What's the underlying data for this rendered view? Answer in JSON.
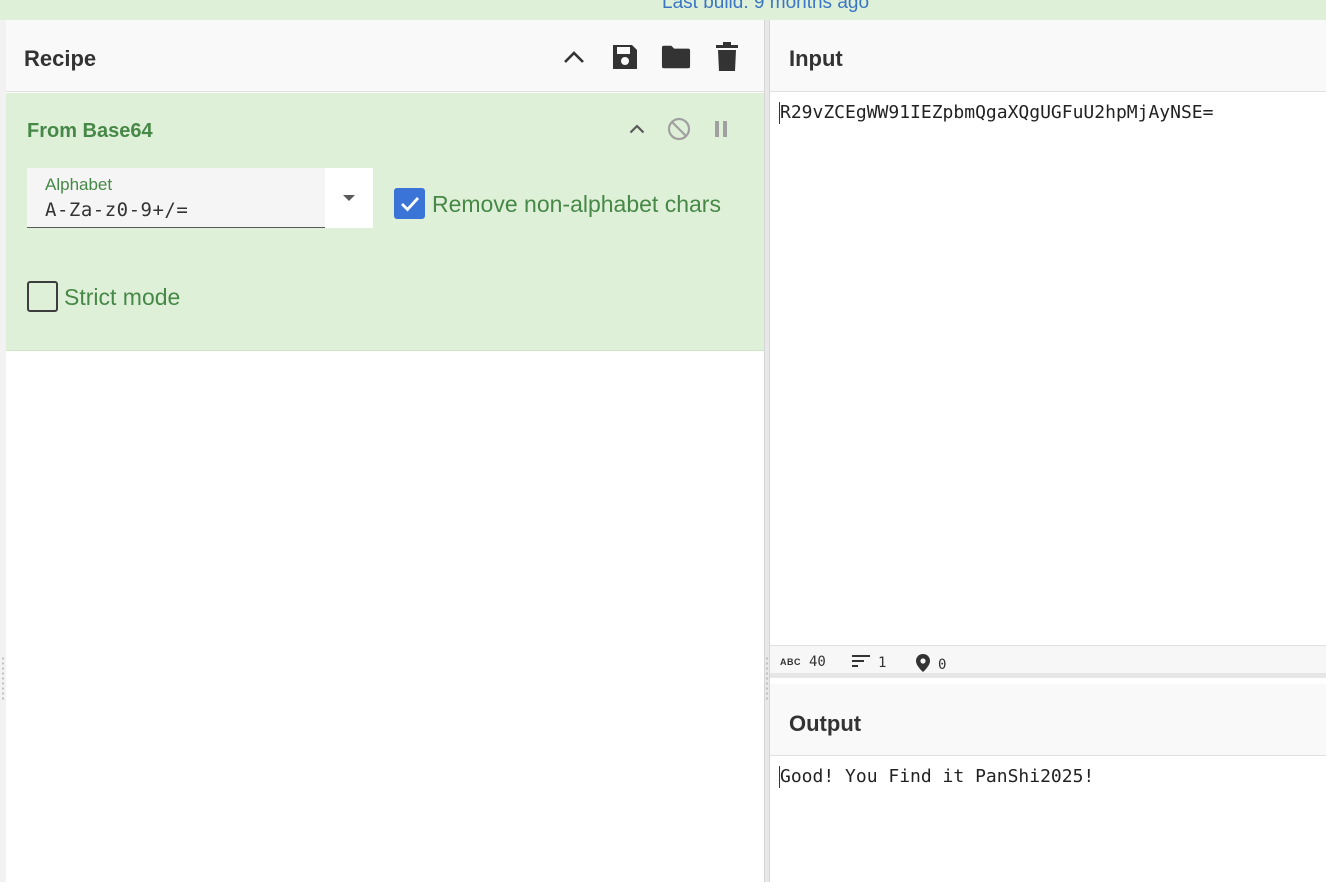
{
  "banner": {
    "text": "Last build: 9 months ago"
  },
  "recipe": {
    "title": "Recipe",
    "icons": [
      "chevron-up-icon",
      "save-icon",
      "folder-icon",
      "trash-icon"
    ],
    "operation": {
      "name": "From Base64",
      "icons": [
        "chevron-up-icon",
        "disable-icon",
        "pause-icon"
      ],
      "alphabet": {
        "label": "Alphabet",
        "value": "A-Za-z0-9+/="
      },
      "remove_non_alphabet": {
        "label": "Remove non-alphabet chars",
        "checked": true
      },
      "strict_mode": {
        "label": "Strict mode",
        "checked": false
      }
    },
    "colors": {
      "accent": "#468847",
      "card_bg": "#dff0d8",
      "checkbox": "#3b74d7"
    }
  },
  "input": {
    "title": "Input",
    "text": "R29vZCEgWW91IEZpbmQgaXQgUGFuU2hpMjAyNSE=",
    "status": {
      "length": "40",
      "lines": "1",
      "position": "0"
    }
  },
  "output": {
    "title": "Output",
    "text": "Good! You Find it PanShi2025!"
  }
}
